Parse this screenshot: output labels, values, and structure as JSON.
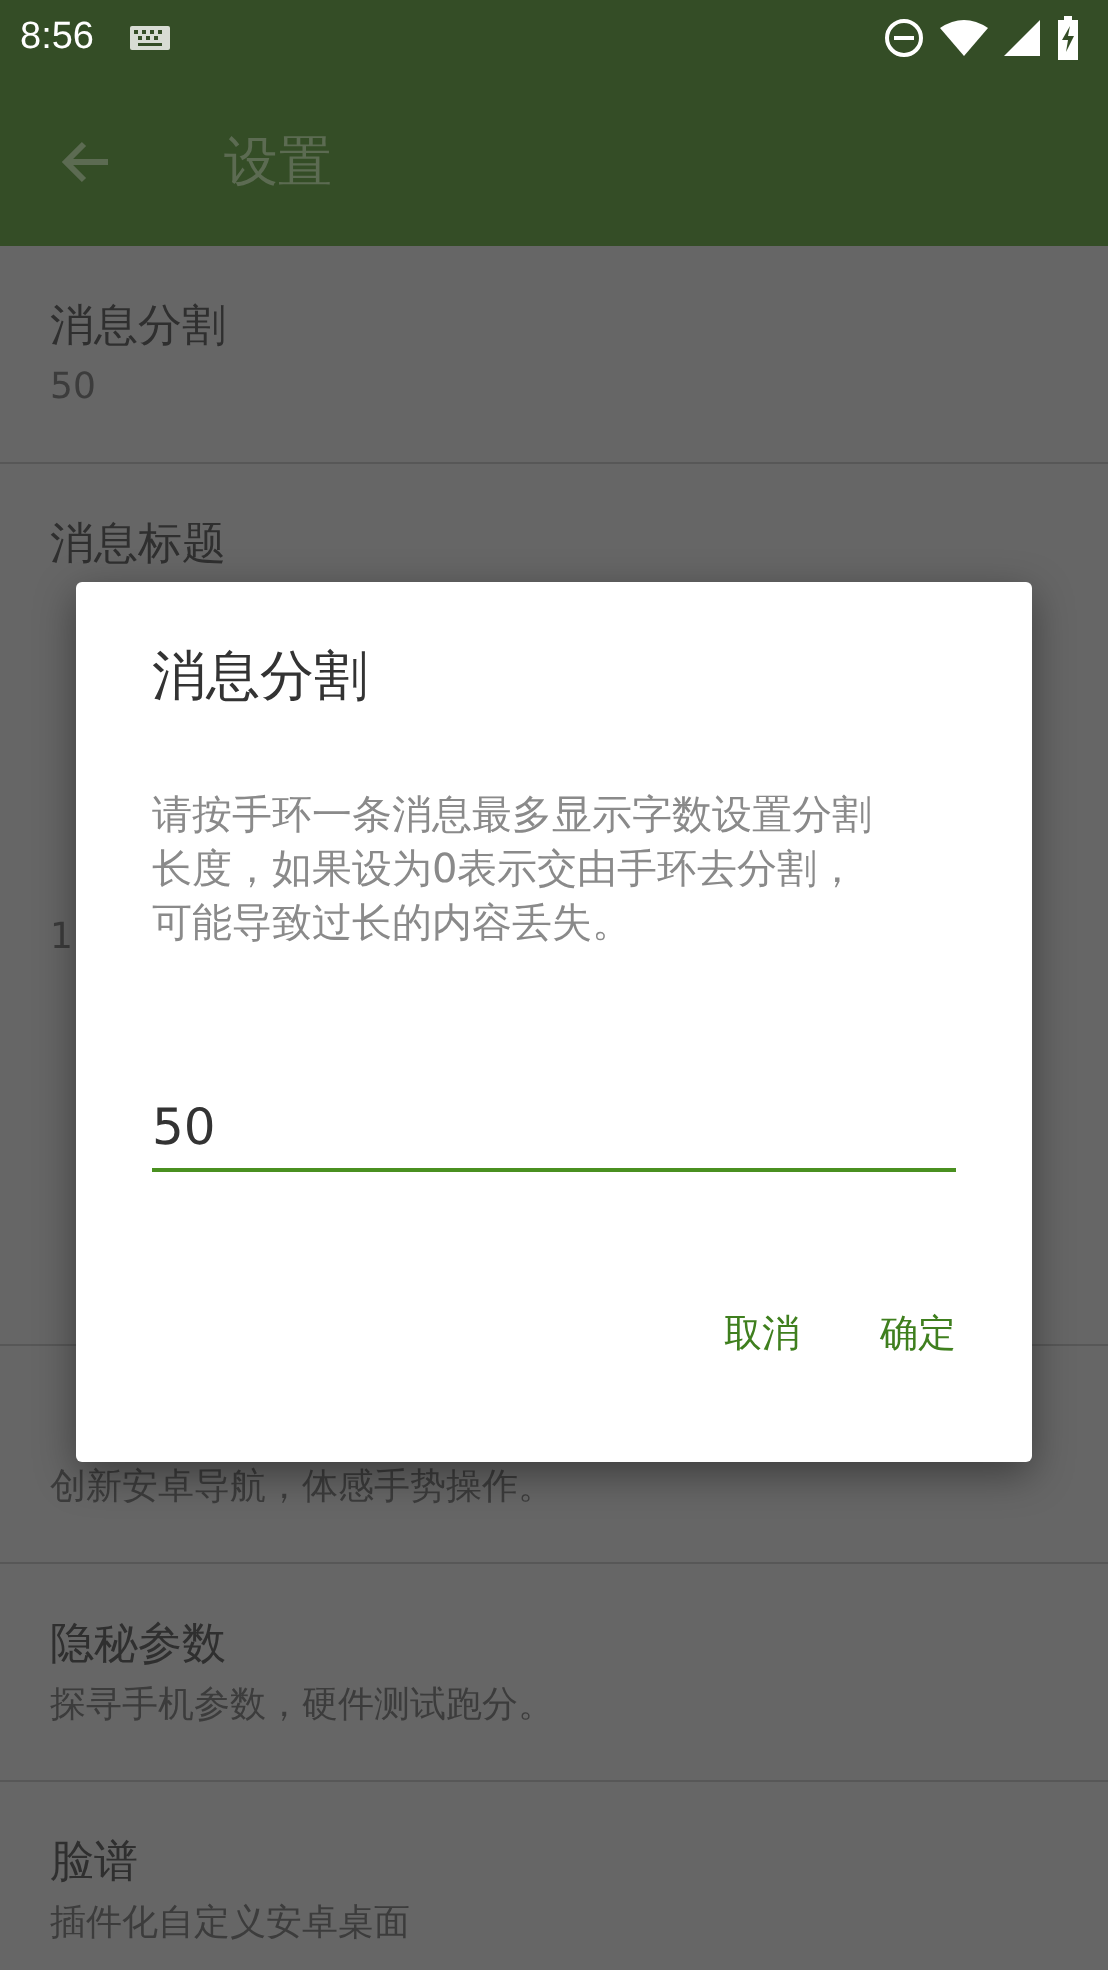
{
  "status_bar": {
    "time": "8:56"
  },
  "app_bar": {
    "title": "设置"
  },
  "list": [
    {
      "kind": "item",
      "title": "消息分割",
      "summary": "50"
    },
    {
      "kind": "item",
      "title": "消息标题"
    },
    {
      "kind": "header"
    },
    {
      "kind": "item",
      "summary": "1"
    },
    {
      "kind": "header"
    },
    {
      "kind": "item"
    },
    {
      "kind": "item",
      "summary": "创新安卓导航，体感手势操作。"
    },
    {
      "kind": "item",
      "title": "隐秘参数",
      "summary": "探寻手机参数，硬件测试跑分。"
    },
    {
      "kind": "item",
      "title": "脸谱",
      "summary": "插件化自定义安卓桌面"
    }
  ],
  "dialog": {
    "title": "消息分割",
    "message": "请按手环一条消息最多显示字数设置分割长度，如果设为0表示交由手环去分割，可能导致过长的内容丢失。",
    "value": "50",
    "buttons": [
      "取消",
      "确定"
    ]
  }
}
